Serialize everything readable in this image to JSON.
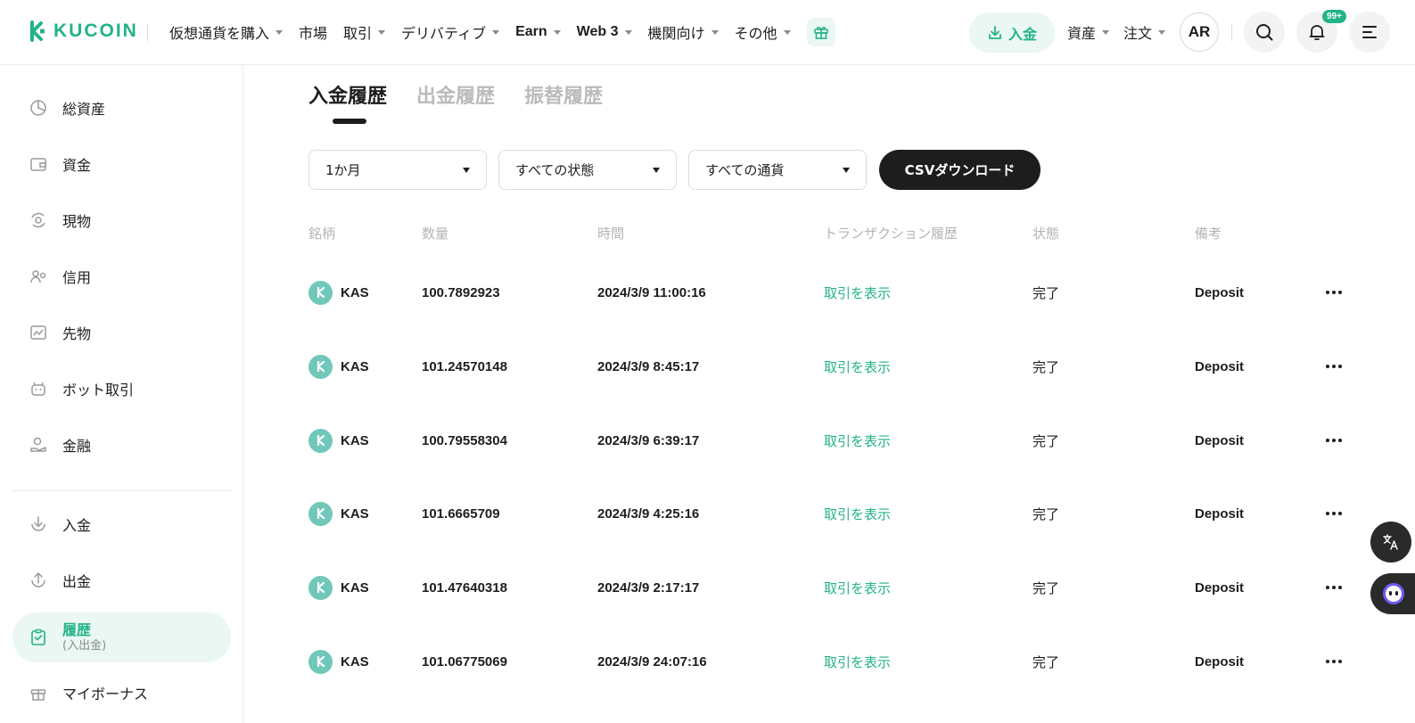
{
  "header": {
    "logo_text": "KUCOIN",
    "nav": [
      {
        "label": "仮想通貨を購入",
        "caret": true,
        "bold": false
      },
      {
        "label": "市場",
        "caret": false,
        "bold": false
      },
      {
        "label": "取引",
        "caret": true,
        "bold": false
      },
      {
        "label": "デリバティブ",
        "caret": true,
        "bold": false
      },
      {
        "label": "Earn",
        "caret": true,
        "bold": true
      },
      {
        "label": "Web 3",
        "caret": true,
        "bold": true
      },
      {
        "label": "機関向け",
        "caret": true,
        "bold": false
      },
      {
        "label": "その他",
        "caret": true,
        "bold": false
      }
    ],
    "deposit_label": "入金",
    "assets_label": "資産",
    "orders_label": "注文",
    "avatar_initials": "AR",
    "notification_badge": "99+",
    "accent_color": "#23b389"
  },
  "sidebar": {
    "items": [
      {
        "label": "総資産",
        "icon": "pie-chart-icon"
      },
      {
        "label": "資金",
        "icon": "wallet-icon"
      },
      {
        "label": "現物",
        "icon": "spot-icon"
      },
      {
        "label": "信用",
        "icon": "margin-icon"
      },
      {
        "label": "先物",
        "icon": "futures-icon"
      },
      {
        "label": "ボット取引",
        "icon": "bot-icon"
      },
      {
        "label": "金融",
        "icon": "finance-icon"
      },
      {
        "label": "入金",
        "icon": "deposit-icon"
      },
      {
        "label": "出金",
        "icon": "withdraw-icon"
      },
      {
        "label": "履歴",
        "sublabel": "(入出金)",
        "icon": "history-icon",
        "active": true
      },
      {
        "label": "マイボーナス",
        "icon": "gift-icon"
      }
    ]
  },
  "main": {
    "tabs": [
      {
        "label": "入金履歴",
        "active": true
      },
      {
        "label": "出金履歴",
        "active": false
      },
      {
        "label": "振替履歴",
        "active": false
      }
    ],
    "filters": {
      "period": "1か月",
      "status": "すべての状態",
      "currency": "すべての通貨"
    },
    "csv_label": "CSVダウンロード",
    "columns": [
      "銘柄",
      "数量",
      "時間",
      "トランザクション履歴",
      "状態",
      "備考"
    ],
    "rows": [
      {
        "coin": "KAS",
        "qty": "100.7892923",
        "time": "2024/3/9 11:00:16",
        "tx": "取引を表示",
        "status": "完了",
        "note": "Deposit"
      },
      {
        "coin": "KAS",
        "qty": "101.24570148",
        "time": "2024/3/9 8:45:17",
        "tx": "取引を表示",
        "status": "完了",
        "note": "Deposit"
      },
      {
        "coin": "KAS",
        "qty": "100.79558304",
        "time": "2024/3/9 6:39:17",
        "tx": "取引を表示",
        "status": "完了",
        "note": "Deposit"
      },
      {
        "coin": "KAS",
        "qty": "101.6665709",
        "time": "2024/3/9 4:25:16",
        "tx": "取引を表示",
        "status": "完了",
        "note": "Deposit"
      },
      {
        "coin": "KAS",
        "qty": "101.47640318",
        "time": "2024/3/9 2:17:17",
        "tx": "取引を表示",
        "status": "完了",
        "note": "Deposit"
      },
      {
        "coin": "KAS",
        "qty": "101.06775069",
        "time": "2024/3/9 24:07:16",
        "tx": "取引を表示",
        "status": "完了",
        "note": "Deposit"
      }
    ]
  }
}
